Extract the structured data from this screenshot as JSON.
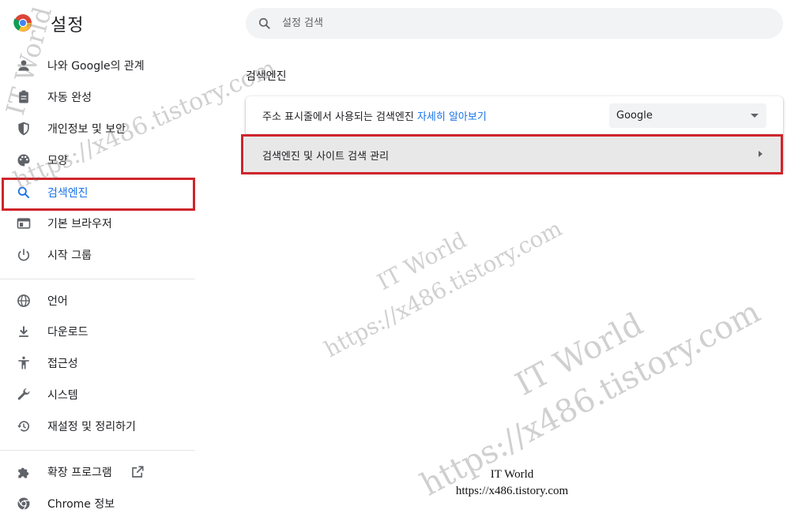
{
  "app": {
    "title": "설정"
  },
  "search": {
    "placeholder": "설정 검색"
  },
  "sidebar": {
    "items": [
      {
        "label": "나와 Google의 관계",
        "icon": "person-icon"
      },
      {
        "label": "자동 완성",
        "icon": "clipboard-icon"
      },
      {
        "label": "개인정보 및 보안",
        "icon": "shield-icon"
      },
      {
        "label": "모양",
        "icon": "palette-icon"
      },
      {
        "label": "검색엔진",
        "icon": "search-icon"
      },
      {
        "label": "기본 브라우저",
        "icon": "browser-icon"
      },
      {
        "label": "시작 그룹",
        "icon": "power-icon"
      },
      {
        "label": "언어",
        "icon": "globe-icon"
      },
      {
        "label": "다운로드",
        "icon": "download-icon"
      },
      {
        "label": "접근성",
        "icon": "accessibility-icon"
      },
      {
        "label": "시스템",
        "icon": "wrench-icon"
      },
      {
        "label": "재설정 및 정리하기",
        "icon": "restore-icon"
      },
      {
        "label": "확장 프로그램",
        "icon": "puzzle-icon"
      },
      {
        "label": "Chrome 정보",
        "icon": "chrome-icon"
      }
    ]
  },
  "main": {
    "section_title": "검색엔진",
    "address_bar_desc": "주소 표시줄에서 사용되는 검색엔진",
    "learn_more": "자세히 알아보기",
    "engine_selected": "Google",
    "manage_label": "검색엔진 및 사이트 검색 관리"
  },
  "watermarks": {
    "brand": "IT World",
    "url": "https://x486.tistory.com"
  },
  "colors": {
    "accent": "#1a73e8",
    "highlight_box": "#d0252b"
  }
}
